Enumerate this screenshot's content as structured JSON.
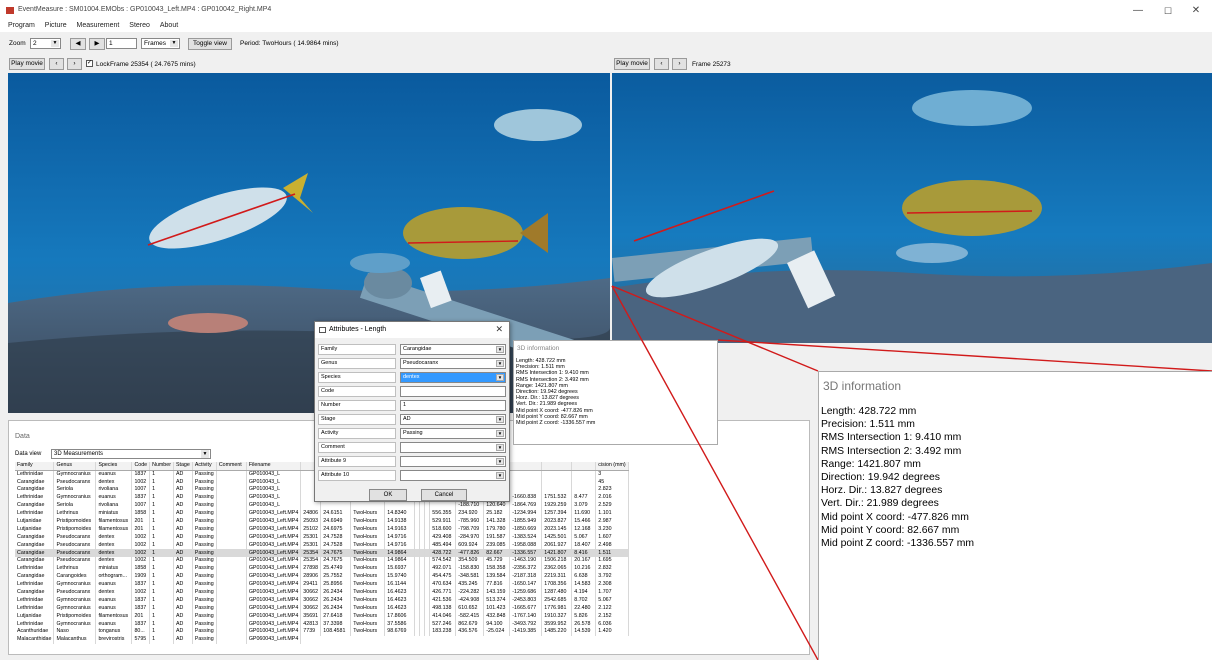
{
  "window": {
    "title": "EventMeasure : SM01004.EMObs : GP010043_Left.MP4 : GP010042_Right.MP4",
    "minimize": "—",
    "maximize": "☐",
    "close": "✕"
  },
  "menu": [
    "Program",
    "Picture",
    "Measurement",
    "Stereo",
    "About"
  ],
  "toolbar": {
    "zoom_label": "Zoom",
    "zoom_value": "2",
    "frame_input": "1",
    "frames_select": "Frames",
    "toggle_view": "Toggle view",
    "period": "Period: TwoHours ( 14.9864 mins)"
  },
  "left_controls": {
    "play": "Play movie",
    "lock_label": "Lock",
    "frame": "Frame 25354 ( 24.7675 mins)"
  },
  "right_controls": {
    "play": "Play movie",
    "frame": "Frame 25273"
  },
  "colors": {
    "measure_line": "#d11a1a",
    "selection": "#3399ff"
  },
  "data": {
    "title": "Data",
    "view_label": "Data view",
    "view_value": "3D Measurements",
    "columns_left": [
      "Family",
      "Genus",
      "Species",
      "Code",
      "Number",
      "Stage",
      "Activity",
      "Comment",
      "Filename"
    ],
    "rows_left": [
      [
        "Lethrinidae",
        "Gymnocranius",
        "euanus",
        "1837",
        "1",
        "AD",
        "Passing",
        "",
        "GP010043_L"
      ],
      [
        "Carangidae",
        "Pseudocaranx",
        "dentex",
        "1002",
        "1",
        "AD",
        "Passing",
        "",
        "GP010043_L"
      ],
      [
        "Carangidae",
        "Seriola",
        "rivoliana",
        "1007",
        "1",
        "AD",
        "Passing",
        "",
        "GP010043_L"
      ],
      [
        "Lethrinidae",
        "Gymnocranius",
        "euanus",
        "1837",
        "1",
        "AD",
        "Passing",
        "",
        "GP010043_L"
      ],
      [
        "Carangidae",
        "Seriola",
        "rivoliana",
        "1007",
        "1",
        "AD",
        "Passing",
        "",
        "GP010043_L"
      ],
      [
        "Lethrinidae",
        "Lethrinus",
        "miniatus",
        "1858",
        "1",
        "AD",
        "Passing",
        "",
        "GP010043_Left.MP4"
      ],
      [
        "Lutjanidae",
        "Pristipomoides",
        "filamentosus",
        "201",
        "1",
        "AD",
        "Passing",
        "",
        "GP010043_Left.MP4"
      ],
      [
        "Lutjanidae",
        "Pristipomoides",
        "filamentosus",
        "201",
        "1",
        "AD",
        "Passing",
        "",
        "GP010043_Left.MP4"
      ],
      [
        "Carangidae",
        "Pseudocaranx",
        "dentex",
        "1002",
        "1",
        "AD",
        "Passing",
        "",
        "GP010043_Left.MP4"
      ],
      [
        "Carangidae",
        "Pseudocaranx",
        "dentex",
        "1002",
        "1",
        "AD",
        "Passing",
        "",
        "GP010043_Left.MP4"
      ],
      [
        "Carangidae",
        "Pseudocaranx",
        "dentex",
        "1002",
        "1",
        "AD",
        "Passing",
        "",
        "GP010043_Left.MP4"
      ],
      [
        "Carangidae",
        "Pseudocaranx",
        "dentex",
        "1002",
        "1",
        "AD",
        "Passing",
        "",
        "GP010043_Left.MP4"
      ],
      [
        "Lethrinidae",
        "Lethrinus",
        "miniatus",
        "1858",
        "1",
        "AD",
        "Passing",
        "",
        "GP010043_Left.MP4"
      ],
      [
        "Carangidae",
        "Carangoides",
        "orthogram...",
        "1909",
        "1",
        "AD",
        "Passing",
        "",
        "GP010043_Left.MP4"
      ],
      [
        "Lethrinidae",
        "Gymnocranius",
        "euanus",
        "1837",
        "1",
        "AD",
        "Passing",
        "",
        "GP010043_Left.MP4"
      ],
      [
        "Carangidae",
        "Pseudocaranx",
        "dentex",
        "1002",
        "1",
        "AD",
        "Passing",
        "",
        "GP010043_Left.MP4"
      ],
      [
        "Lethrinidae",
        "Gymnocranius",
        "euanus",
        "1837",
        "1",
        "AD",
        "Passing",
        "",
        "GP010043_Left.MP4"
      ],
      [
        "Lethrinidae",
        "Gymnocranius",
        "euanus",
        "1837",
        "1",
        "AD",
        "Passing",
        "",
        "GP010043_Left.MP4"
      ],
      [
        "Lutjanidae",
        "Pristipomoides",
        "filamentosus",
        "201",
        "1",
        "AD",
        "Passing",
        "",
        "GP010043_Left.MP4"
      ],
      [
        "Lethrinidae",
        "Gymnocranius",
        "euanus",
        "1837",
        "1",
        "AD",
        "Passing",
        "",
        "GP010043_Left.MP4"
      ],
      [
        "Acanthuridae",
        "Naso",
        "tonganus",
        "80...",
        "1",
        "AD",
        "Passing",
        "",
        "GP010043_Left.MP4"
      ],
      [
        "Malacanthidae",
        "Malacanthus",
        "brevirostris",
        "5795",
        "1",
        "AD",
        "Passing",
        "",
        "GP060043_Left.MP4"
      ]
    ],
    "columns_right": [
      "",
      "",
      "",
      "",
      "",
      "",
      "",
      "",
      "",
      "",
      "",
      "",
      "",
      "cision (mm)"
    ],
    "rows_right": [
      [
        "",
        "",
        "",
        "",
        "",
        "",
        "",
        "",
        "",
        "",
        "",
        "",
        "",
        "3"
      ],
      [
        "",
        "",
        "",
        "",
        "",
        "",
        "",
        "",
        "",
        "",
        "",
        "",
        "",
        "45"
      ],
      [
        "",
        "",
        "",
        "",
        "",
        "",
        "",
        "",
        "",
        "",
        "",
        "",
        "",
        "2.823"
      ],
      [
        "",
        "",
        "",
        "",
        "",
        "",
        "",
        "983",
        "-428.909",
        "353.817",
        "-1660.838",
        "1751.532",
        "8.477",
        "2.016"
      ],
      [
        "",
        "",
        "",
        "",
        "",
        "",
        "",
        "",
        "-188.710",
        "120.640",
        "-1864.769",
        "1929.259",
        "3.079",
        "2.529"
      ],
      [
        "24806",
        "24.6151",
        "TwoHours",
        "14.8340",
        "",
        "",
        "",
        "556.355",
        "234.920",
        "25.182",
        "-1234.994",
        "1257.394",
        "11.690",
        "1.101"
      ],
      [
        "25093",
        "24.6949",
        "TwoHours",
        "14.9138",
        "",
        "",
        "",
        "529.911",
        "-785.960",
        "141.328",
        "-1855.949",
        "2023.827",
        "15.466",
        "2.987"
      ],
      [
        "25102",
        "24.6975",
        "TwoHours",
        "14.9163",
        "",
        "",
        "",
        "518.600",
        "-798.709",
        "179.780",
        "-1850.669",
        "2023.145",
        "12.168",
        "3.230"
      ],
      [
        "25301",
        "24.7528",
        "TwoHours",
        "14.9716",
        "",
        "",
        "",
        "429.408",
        "-284.970",
        "191.587",
        "-1383.524",
        "1425.501",
        "5.067",
        "1.607"
      ],
      [
        "25301",
        "24.7528",
        "TwoHours",
        "14.9716",
        "",
        "",
        "",
        "485.494",
        "609.924",
        "239.085",
        "-1958.088",
        "2061.927",
        "18.407",
        "2.498"
      ],
      [
        "25354",
        "24.7675",
        "TwoHours",
        "14.9864",
        "",
        "",
        "",
        "428.722",
        "-477.826",
        "82.667",
        "-1336.557",
        "1421.807",
        "8.416",
        "1.511"
      ],
      [
        "25354",
        "24.7675",
        "TwoHours",
        "14.9864",
        "",
        "",
        "",
        "574.542",
        "354.509",
        "45.729",
        "-1463.190",
        "1506.218",
        "20.167",
        "1.695"
      ],
      [
        "27898",
        "25.4749",
        "TwoHours",
        "15.6937",
        "",
        "",
        "",
        "492.071",
        "-158.830",
        "158.358",
        "-2356.372",
        "2362.065",
        "10.216",
        "2.832"
      ],
      [
        "28906",
        "25.7552",
        "TwoHours",
        "15.9740",
        "",
        "",
        "",
        "454.475",
        "-348.581",
        "139.584",
        "-2187.318",
        "2219.311",
        "6.638",
        "3.792"
      ],
      [
        "29411",
        "25.8956",
        "TwoHours",
        "16.1144",
        "",
        "",
        "",
        "470.634",
        "435.245",
        "77.816",
        "-1650.147",
        "1708.356",
        "14.583",
        "2.308"
      ],
      [
        "30662",
        "26.2434",
        "TwoHours",
        "16.4623",
        "",
        "",
        "",
        "426.771",
        "-224.282",
        "143.159",
        "-1259.686",
        "1287.480",
        "4.194",
        "1.707"
      ],
      [
        "30662",
        "26.2434",
        "TwoHours",
        "16.4623",
        "",
        "",
        "",
        "421.536",
        "-424.908",
        "513.374",
        "-2453.803",
        "2542.685",
        "8.702",
        "5.067"
      ],
      [
        "30662",
        "26.2434",
        "TwoHours",
        "16.4623",
        "",
        "",
        "",
        "498.138",
        "610.652",
        "101.423",
        "-1665.677",
        "1776.981",
        "22.480",
        "2.122"
      ],
      [
        "35691",
        "27.6418",
        "TwoHours",
        "17.8606",
        "",
        "",
        "",
        "414.046",
        "-582.415",
        "432.848",
        "-1767.140",
        "1910.327",
        "5.826",
        "2.152"
      ],
      [
        "42813",
        "37.3398",
        "TwoHours",
        "37.5586",
        "",
        "",
        "",
        "527.246",
        "862.679",
        "94.100",
        "-3493.792",
        "3599.952",
        "26.578",
        "6.036"
      ],
      [
        "7739",
        "108.4581",
        "TwoHours",
        "98.6769",
        "",
        "",
        "",
        "183.238",
        "436.576",
        "-25.024",
        "-1419.385",
        "1485.220",
        "14.539",
        "1.420"
      ]
    ],
    "selected_row": 10
  },
  "dialog": {
    "title": "Attributes - Length",
    "close": "✕",
    "fields": [
      {
        "label": "Family",
        "value": "Carangidae",
        "dropdown": true
      },
      {
        "label": "Genus",
        "value": "Pseudocaranx",
        "dropdown": true
      },
      {
        "label": "Species",
        "value": "dentex",
        "dropdown": true,
        "highlight": true
      },
      {
        "label": "Code",
        "value": "",
        "dropdown": false
      },
      {
        "label": "Number",
        "value": "1",
        "dropdown": false
      },
      {
        "label": "Stage",
        "value": "AD",
        "dropdown": true
      },
      {
        "label": "Activity",
        "value": "Passing",
        "dropdown": true
      },
      {
        "label": "Comment",
        "value": "",
        "dropdown": true
      },
      {
        "label": "Attribute 9",
        "value": "",
        "dropdown": true
      },
      {
        "label": "Attribute 10",
        "value": "",
        "dropdown": true
      }
    ],
    "ok": "OK",
    "cancel": "Cancel"
  },
  "info_small": {
    "title": "3D information",
    "lines": [
      "Length: 428.722 mm",
      "Precision: 1.511 mm",
      "RMS Intersection 1: 9.410 mm",
      "RMS Intersection 2: 3.492 mm",
      "Range: 1421.807 mm",
      "Direction: 19.942 degrees",
      "Horz. Dir.: 13.827 degrees",
      "Vert. Dir.: 21.989 degrees",
      "Mid point X coord: -477.826 mm",
      "Mid point Y coord: 82.667 mm",
      "Mid point Z coord: -1336.557 mm"
    ]
  },
  "info_big": {
    "title": "3D information",
    "lines": [
      "Length: 428.722 mm",
      "Precision: 1.511 mm",
      "RMS Intersection 1: 9.410 mm",
      "RMS Intersection 2: 3.492 mm",
      "Range: 1421.807 mm",
      "Direction: 19.942 degrees",
      "Horz. Dir.: 13.827 degrees",
      "Vert. Dir.: 21.989 degrees",
      "Mid point X coord: -477.826 mm",
      "Mid point Y coord: 82.667 mm",
      "Mid point Z coord: -1336.557 mm"
    ]
  }
}
